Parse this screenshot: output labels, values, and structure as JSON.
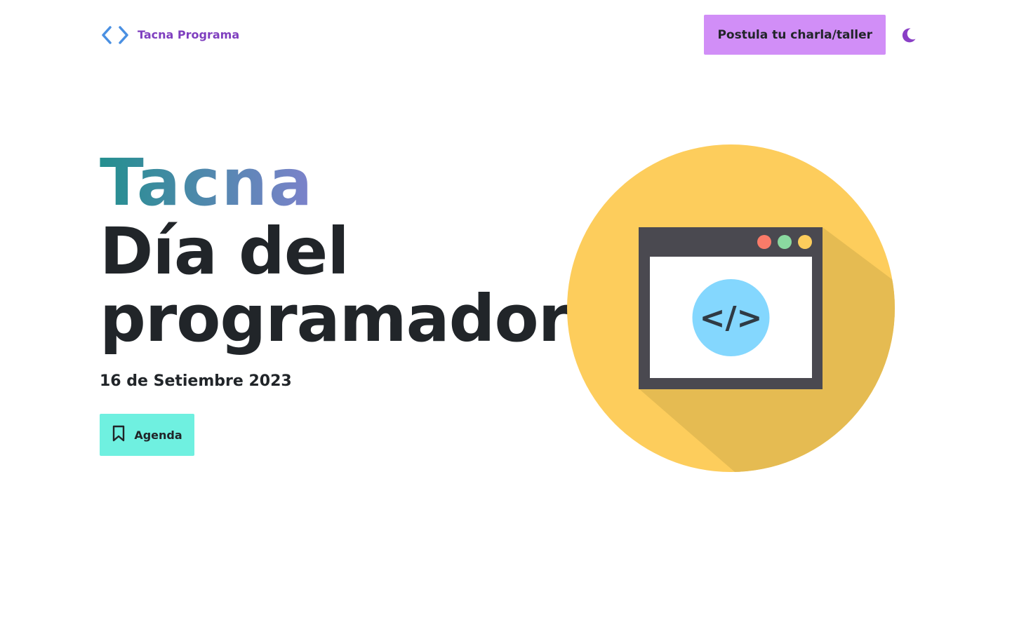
{
  "header": {
    "brand_name": "Tacna Programa",
    "cta_label": "Postula tu charla/taller",
    "theme_icon": "moon-icon",
    "brand_icon": "code-brackets-icon"
  },
  "hero": {
    "city": "Tacna",
    "title_line1": "Día del",
    "title_line2": "programador",
    "date": "16 de Setiembre 2023",
    "agenda_label": "Agenda",
    "agenda_icon": "bookmark-icon"
  },
  "illustration": {
    "code_symbol": "</>",
    "icon": "browser-window-code-icon"
  },
  "colors": {
    "brand": "#7f3fbf",
    "cta_bg": "#d18ef7",
    "agenda_bg": "#6ff0e0",
    "circle": "#fdcd5c",
    "circle_shadow": "#e5bb52",
    "window_frame": "#4a4950",
    "code_circle": "#84d7fe",
    "dot_red": "#fa7b69",
    "dot_green": "#8ad9a0",
    "dot_yellow": "#fdcd5c"
  }
}
